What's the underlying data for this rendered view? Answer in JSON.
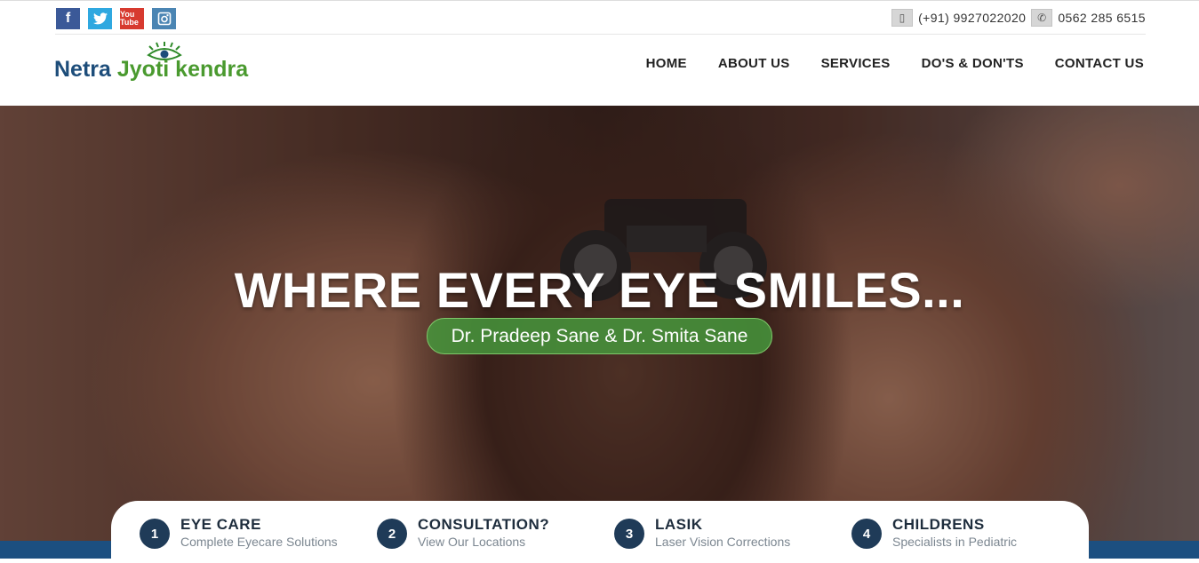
{
  "social": [
    {
      "name": "facebook",
      "glyph": "f"
    },
    {
      "name": "twitter",
      "glyph": "t"
    },
    {
      "name": "youtube",
      "glyph": "You Tube"
    },
    {
      "name": "instagram",
      "glyph": "◙"
    }
  ],
  "contact": {
    "mobile": "(+91) 9927022020",
    "phone": "0562 285 6515"
  },
  "logo": {
    "part1": "Netra ",
    "part2": "Jyoti kendra"
  },
  "nav": [
    "HOME",
    "ABOUT US",
    "SERVICES",
    "DO'S & DON'TS",
    "CONTACT US"
  ],
  "hero": {
    "title": "WHERE EVERY EYE SMILES...",
    "subtitle": "Dr. Pradeep Sane & Dr. Smita Sane"
  },
  "features": [
    {
      "num": "1",
      "title": "EYE CARE",
      "sub": "Complete Eyecare Solutions"
    },
    {
      "num": "2",
      "title": "CONSULTATION?",
      "sub": "View Our Locations"
    },
    {
      "num": "3",
      "title": "LASIK",
      "sub": "Laser Vision Corrections"
    },
    {
      "num": "4",
      "title": "CHILDRENS",
      "sub": "Specialists in Pediatric"
    }
  ],
  "colors": {
    "brand_blue": "#1d4d7a",
    "brand_green": "#4a9a2f",
    "pill_green": "#46963c",
    "band_blue": "#1c4f80"
  }
}
